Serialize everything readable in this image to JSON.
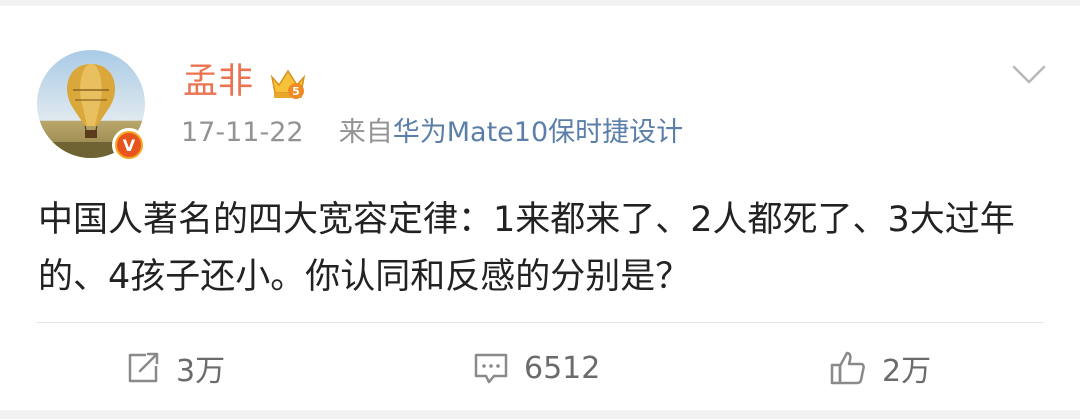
{
  "post": {
    "author": "孟非",
    "date": "17-11-22",
    "source_prefix": "来自",
    "source": "华为Mate10保时捷设计",
    "content": "中国人著名的四大宽容定律：1来都来了、2人都死了、3大过年的、4孩子还小。你认同和反感的分别是？",
    "verified_badge": "V",
    "crown_badge": "5"
  },
  "actions": {
    "repost_count": "3万",
    "comment_count": "6512",
    "like_count": "2万"
  },
  "icons": {
    "menu": "chevron-down-icon",
    "repost": "repost-icon",
    "comment": "comment-icon",
    "like": "thumbs-up-icon"
  },
  "colors": {
    "username": "#eb7350",
    "source": "#5b7fa8",
    "meta": "#939393",
    "badge": "#e8541e"
  }
}
